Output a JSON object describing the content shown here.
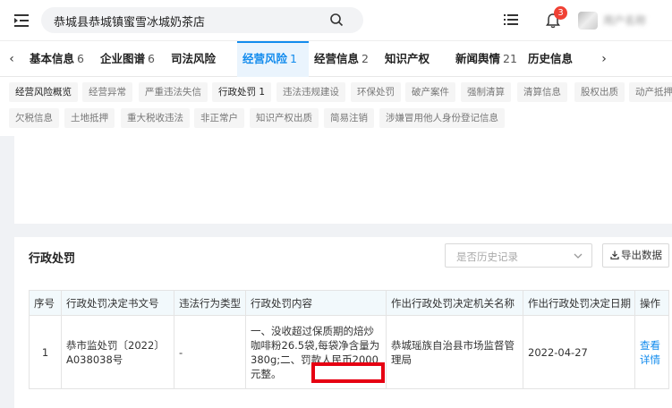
{
  "header": {
    "search_value": "恭城县恭城镇蜜雪冰城奶茶店",
    "notification_count": "3",
    "username": "用户名称"
  },
  "tabs": [
    {
      "label": "基本信息",
      "count": "6"
    },
    {
      "label": "企业图谱",
      "count": "6"
    },
    {
      "label": "司法风险",
      "count": ""
    },
    {
      "label": "经营风险",
      "count": "1"
    },
    {
      "label": "经营信息",
      "count": "2"
    },
    {
      "label": "知识产权",
      "count": ""
    },
    {
      "label": "新闻舆情",
      "count": "21"
    },
    {
      "label": "历史信息",
      "count": ""
    }
  ],
  "subtags_row1": [
    "经营风险概览",
    "经营异常",
    "严重违法失信",
    "行政处罚 1",
    "违法违规建设",
    "环保处罚",
    "破产案件",
    "强制清算",
    "清算信息",
    "股权出质",
    "动产抵押"
  ],
  "subtags_row2": [
    "欠税信息",
    "土地抵押",
    "重大税收违法",
    "非正常户",
    "知识产权出质",
    "简易注销",
    "涉嫌冒用他人身份登记信息"
  ],
  "section": {
    "title": "行政处罚",
    "history_placeholder": "是否历史记录",
    "export_label": "导出数据"
  },
  "table": {
    "headers": [
      "序号",
      "行政处罚决定书文号",
      "违法行为类型",
      "行政处罚内容",
      "作出行政处罚决定机关名称",
      "作出行政处罚决定日期",
      "操作"
    ],
    "rows": [
      {
        "index": "1",
        "doc_no": "恭市监处罚〔2022〕A038038号",
        "violation_type": "-",
        "content": "一、没收超过保质期的焙炒咖啡粉26.5袋,每袋净含量为380g;二、罚款人民币2000元整。",
        "authority": "恭城瑶族自治县市场监督管理局",
        "date": "2022-04-27",
        "action": "查看详情"
      }
    ]
  }
}
